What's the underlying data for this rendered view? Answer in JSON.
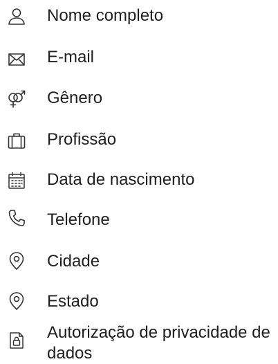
{
  "fields": [
    {
      "label": "Nome completo",
      "icon": "person-icon"
    },
    {
      "label": "E-mail",
      "icon": "envelope-icon"
    },
    {
      "label": "Gênero",
      "icon": "gender-icon"
    },
    {
      "label": "Profissão",
      "icon": "briefcase-icon"
    },
    {
      "label": "Data de nascimento",
      "icon": "calendar-icon"
    },
    {
      "label": "Telefone",
      "icon": "phone-icon"
    },
    {
      "label": "Cidade",
      "icon": "map-pin-icon"
    },
    {
      "label": "Estado",
      "icon": "map-pin-icon"
    },
    {
      "label": "Autorização de privacidade de dados",
      "icon": "lock-document-icon"
    }
  ]
}
